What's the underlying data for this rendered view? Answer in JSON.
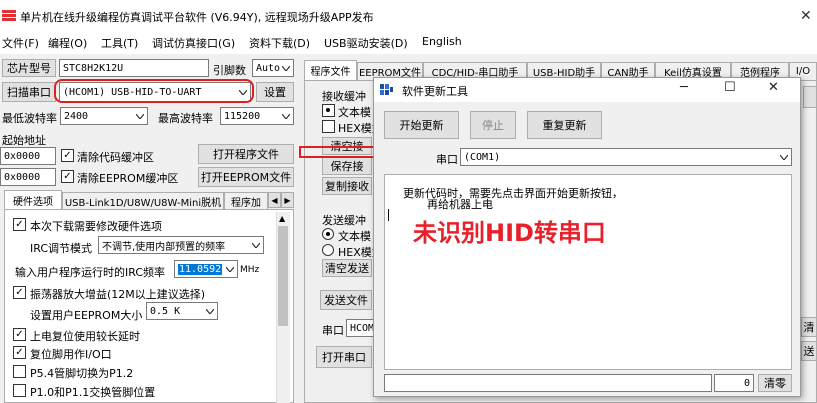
{
  "app": {
    "title": "单片机在线升级编程仿真调试平台软件 (V6.94Y), 远程现场升级APP发布"
  },
  "menu": [
    "文件(F)",
    "编程(O)",
    "工具(T)",
    "调试仿真接口(G)",
    "资料下载(D)",
    "USB驱动安装(D)",
    "English"
  ],
  "left": {
    "chip_model_btn": "芯片型号",
    "chip_model_value": "STC8H2K12U",
    "pins_label": "引脚数",
    "pins_value": "Auto",
    "scan_port_btn": "扫描串口",
    "port_value": "(HCOM1) USB-HID-TO-UART",
    "settings_btn": "设置",
    "min_baud_label": "最低波特率",
    "min_baud_value": "2400",
    "max_baud_label": "最高波特率",
    "max_baud_value": "115200",
    "start_addr_label": "起始地址",
    "addr1_value": "0x0000",
    "clear_code_label": "清除代码缓冲区",
    "open_program_btn": "打开程序文件",
    "addr2_value": "0x0000",
    "clear_eeprom_label": "清除EEPROM缓冲区",
    "open_eeprom_btn": "打开EEPROM文件",
    "tabs": [
      "硬件选项",
      "USB-Link1D/U8W/U8W-Mini脱机",
      "程序加"
    ],
    "hw": {
      "opt1": "本次下载需要修改硬件选项",
      "irc_mode_label": "IRC调节模式",
      "irc_mode_value": "不调节,使用内部预置的频率",
      "irc_freq_label": "输入用户程序运行时的IRC频率",
      "irc_freq_value": "11.0592",
      "irc_freq_unit": "MHz",
      "osc_gain": "振荡器放大增益(12M以上建议选择)",
      "eeprom_size_label": "设置用户EEPROM大小",
      "eeprom_size_value": "0.5 K",
      "power_reset": "上电复位使用较长延时",
      "reset_io": "复位脚用作I/O口",
      "p54": "P5.4管脚切换为P1.2",
      "p10": "P1.0和P1.1交换管脚位置"
    }
  },
  "right": {
    "tabs": [
      "程序文件",
      "EEPROM文件",
      "CDC/HID-串口助手",
      "USB-HID助手",
      "CAN助手",
      "Keil仿真设置",
      "范例程序",
      "I/O"
    ],
    "recv_buffer_label": "接收缓冲",
    "text_mode": "文本模",
    "hex_mode": "HEX模式",
    "clear_recv": "清空接",
    "save_recv": "保存接",
    "copy_recv": "复制接收",
    "send_buffer_label": "发送缓冲",
    "send_text": "文本模",
    "send_hex": "HEX模式",
    "clear_send": "清空发送",
    "send_file": "发送文件",
    "port_label": "串口",
    "port_value": "HCOM",
    "open_port": "打开串口",
    "clear_btn2": "清",
    "stat_btn": "送"
  },
  "dialog": {
    "title": "软件更新工具",
    "start_update": "开始更新",
    "stop": "停止",
    "restart_update": "重复更新",
    "port_label": "串口",
    "port_value": "(COM1)",
    "message_line1": "更新代码时，需要先点击界面开始更新按钮，",
    "message_line2": "再给机器上电",
    "status_count": "0",
    "clear_btn": "清零"
  },
  "annotation": {
    "text": "未识别HID转串口",
    "color": "#e8202a"
  },
  "colors": {
    "highlight": "#0078d7",
    "annotation_red": "#e02020"
  }
}
